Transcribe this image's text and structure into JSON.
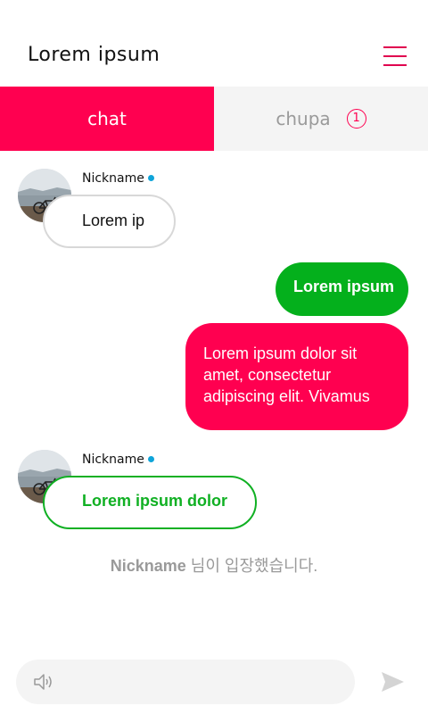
{
  "header": {
    "title": "Lorem ipsum"
  },
  "tabs": [
    {
      "label": "chat",
      "active": true
    },
    {
      "label": "chupa",
      "badge": "1"
    }
  ],
  "messages": [
    {
      "nickname": "Nickname",
      "text": "Lorem ip"
    },
    {
      "text": "Lorem ipsum"
    },
    {
      "text": "Lorem ipsum dolor sit amet, consectetur adipiscing elit. Vivamus"
    },
    {
      "nickname": "Nickname",
      "text": "Lorem ipsum dolor"
    }
  ],
  "system": {
    "nickname": "Nickname",
    "text": " 님이 입장했습니다."
  },
  "composer": {
    "placeholder": ""
  },
  "colors": {
    "accent": "#ff0050",
    "green": "#04b01c",
    "online": "#0fa4d9"
  },
  "icons": [
    "menu-icon",
    "speaker-icon",
    "send-icon"
  ]
}
